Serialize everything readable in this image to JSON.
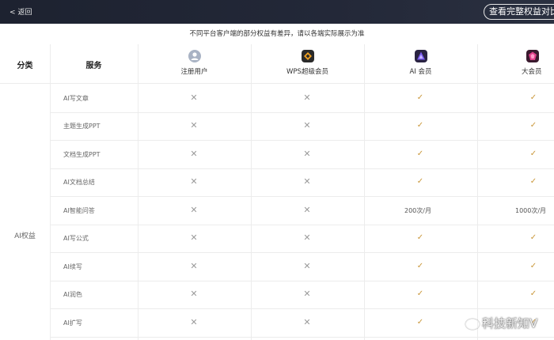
{
  "header": {
    "back_label": "返回",
    "compare_button": "查看完整权益对比"
  },
  "notice": "不同平台客户端的部分权益有差异，请以各端实际展示为准",
  "table": {
    "category_header": "分类",
    "service_header": "服务",
    "plans": [
      {
        "name": "注册用户",
        "icon": "user-icon",
        "color": "#a9b3c4"
      },
      {
        "name": "WPS超级会员",
        "icon": "wps-super-member-icon",
        "color": "#f0a020"
      },
      {
        "name": "AI 会员",
        "icon": "ai-member-icon",
        "color": "#7b5cf0"
      },
      {
        "name": "大会员",
        "icon": "big-member-icon",
        "color": "#e0408a"
      }
    ],
    "category": "AI权益",
    "rows": [
      {
        "service": "AI写文章",
        "cells": [
          "x",
          "x",
          "check",
          "check"
        ]
      },
      {
        "service": "主题生成PPT",
        "cells": [
          "x",
          "x",
          "check",
          "check"
        ]
      },
      {
        "service": "文档生成PPT",
        "cells": [
          "x",
          "x",
          "check",
          "check"
        ]
      },
      {
        "service": "AI文档总结",
        "cells": [
          "x",
          "x",
          "check",
          "check"
        ]
      },
      {
        "service": "AI智能问答",
        "cells": [
          "x",
          "x",
          "200次/月",
          "1000次/月"
        ]
      },
      {
        "service": "AI写公式",
        "cells": [
          "x",
          "x",
          "check",
          "check"
        ]
      },
      {
        "service": "AI续写",
        "cells": [
          "x",
          "x",
          "check",
          "check"
        ]
      },
      {
        "service": "AI润色",
        "cells": [
          "x",
          "x",
          "check",
          "check"
        ]
      },
      {
        "service": "AI扩写",
        "cells": [
          "x",
          "x",
          "check",
          "check"
        ]
      }
    ]
  },
  "colors": {
    "topbar": "#1d2230",
    "check": "#c9973a",
    "cross": "#9a9a9a"
  },
  "watermark": "科技新知V"
}
